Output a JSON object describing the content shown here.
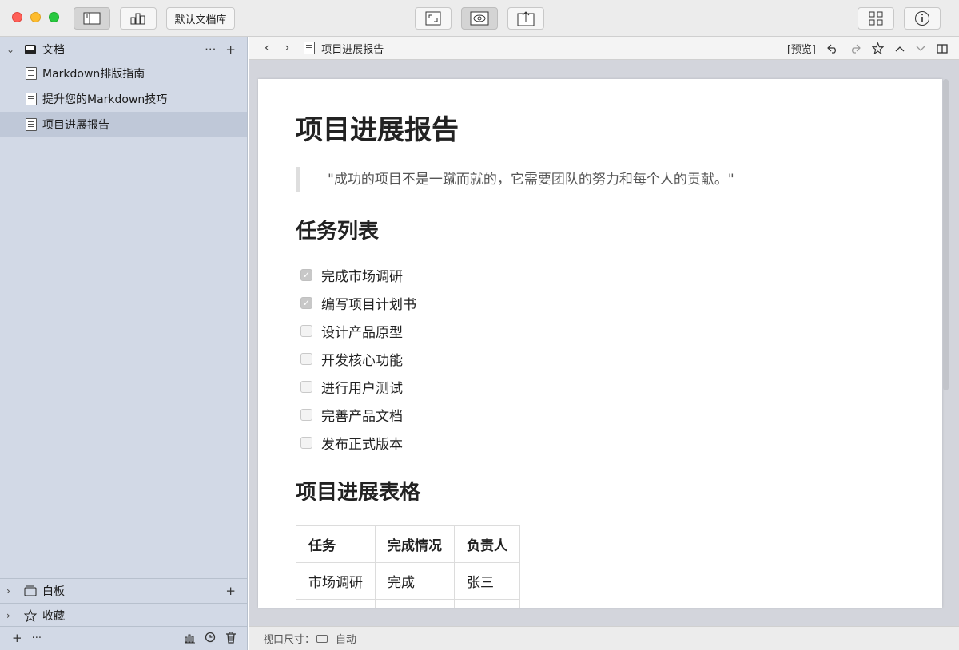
{
  "toolbar": {
    "library_label": "默认文档库"
  },
  "sidebar": {
    "docs_section": "文档",
    "docs_more": "···",
    "docs_add": "+",
    "items": [
      {
        "label": "Markdown排版指南"
      },
      {
        "label": "提升您的Markdown技巧"
      },
      {
        "label": "项目进展报告"
      }
    ],
    "whiteboard_section": "白板",
    "whiteboard_add": "+",
    "favorites_section": "收藏",
    "bottom_add": "+",
    "bottom_more": "···"
  },
  "nav": {
    "back": "‹",
    "forward": "›",
    "title": "项目进展报告",
    "preview_label": "[预览]"
  },
  "document": {
    "title": "项目进展报告",
    "quote": "\"成功的项目不是一蹴而就的，它需要团队的努力和每个人的贡献。\"",
    "tasks_heading": "任务列表",
    "tasks": [
      {
        "label": "完成市场调研",
        "checked": true
      },
      {
        "label": "编写项目计划书",
        "checked": true
      },
      {
        "label": "设计产品原型",
        "checked": false
      },
      {
        "label": "开发核心功能",
        "checked": false
      },
      {
        "label": "进行用户测试",
        "checked": false
      },
      {
        "label": "完善产品文档",
        "checked": false
      },
      {
        "label": "发布正式版本",
        "checked": false
      }
    ],
    "table_heading": "项目进展表格",
    "table": {
      "headers": [
        "任务",
        "完成情况",
        "负责人"
      ],
      "rows": [
        [
          "市场调研",
          "完成",
          "张三"
        ]
      ]
    }
  },
  "status": {
    "viewport_label": "视口尺寸：",
    "viewport_value": "自动"
  }
}
